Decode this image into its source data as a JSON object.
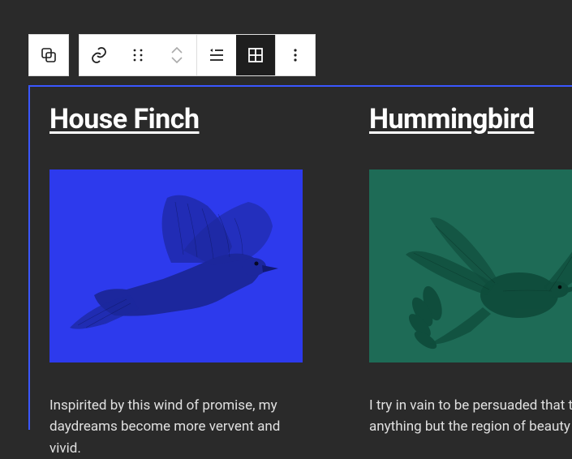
{
  "columns": [
    {
      "title": "House Finch",
      "body": "Inspirited by this wind of promise, my daydreams become more vervent and vivid.",
      "image_bg": "#2d3aed",
      "image_alt": "house-finch-illustration"
    },
    {
      "title": "Hummingbird",
      "body": "I try in vain to be persuaded that the anything but the region of beauty and",
      "image_bg": "#1e6b56",
      "image_alt": "hummingbird-illustration"
    }
  ],
  "toolbar": {
    "group_icon": "group",
    "link_icon": "link",
    "drag_icon": "drag",
    "move_up_icon": "chevron-up",
    "move_down_icon": "chevron-down",
    "list_icon": "list-outdent",
    "grid_icon": "grid",
    "more_icon": "more-vertical"
  }
}
